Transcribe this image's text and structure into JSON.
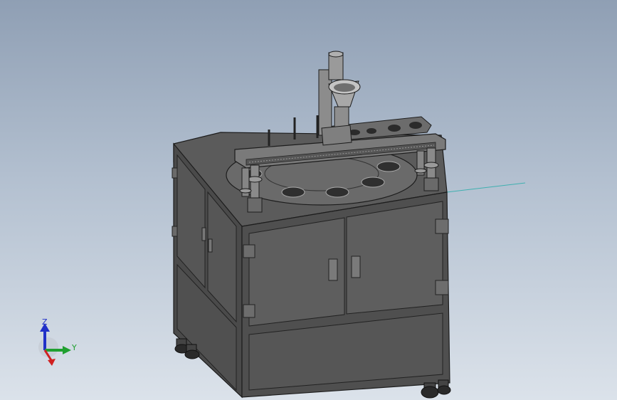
{
  "viewport": {
    "background_top": "#8f9fb4",
    "background_bottom": "#dbe2ea"
  },
  "model": {
    "frame_color": "#3a3a3a",
    "panel_color": "#5a5a5a",
    "edge_color": "#1c1c1c",
    "reference_line_color": "#3fb0b0"
  },
  "triad": {
    "z_label": "Z",
    "y_label": "Y",
    "z_color": "#2030c8",
    "y_color": "#20a030",
    "x_color": "#d02020",
    "z_icon": "arrow-up-icon",
    "y_icon": "arrow-right-icon",
    "x_icon": "arrow-out-icon"
  }
}
